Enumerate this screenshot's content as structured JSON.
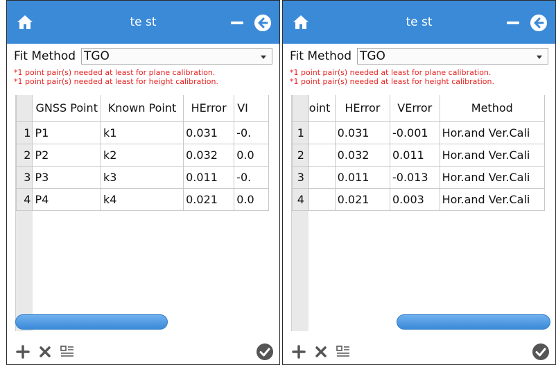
{
  "accent_color": "#3a8ad8",
  "window": {
    "title": "te st"
  },
  "fit_method": {
    "label": "Fit Method",
    "value": "TGO"
  },
  "warnings": [
    "*1 point pair(s) needed at least for plane calibration.",
    "*1 point pair(s) needed at least for height calibration."
  ],
  "icons": {
    "home": "home-icon",
    "minimize": "minimize-icon",
    "back": "back-arrow-icon",
    "add": "plus-icon",
    "delete": "x-icon",
    "list": "list-icon",
    "confirm": "check-circle-icon"
  },
  "left_table": {
    "headers": [
      "GNSS Point",
      "Known Point",
      "HError",
      "VI"
    ],
    "rows": [
      {
        "n": "1",
        "gnss": "P1",
        "known": "k1",
        "herror": "0.031",
        "partial": "-0."
      },
      {
        "n": "2",
        "gnss": "P2",
        "known": "k2",
        "herror": "0.032",
        "partial": "0.0"
      },
      {
        "n": "3",
        "gnss": "P3",
        "known": "k3",
        "herror": "0.011",
        "partial": "-0."
      },
      {
        "n": "4",
        "gnss": "P4",
        "known": "k4",
        "herror": "0.021",
        "partial": "0.0"
      }
    ]
  },
  "right_table": {
    "headers": [
      "oint",
      "HError",
      "VError",
      "Method"
    ],
    "rows": [
      {
        "n": "1",
        "herror": "0.031",
        "verror": "-0.001",
        "method": "Hor.and Ver.Cali"
      },
      {
        "n": "2",
        "herror": "0.032",
        "verror": "0.011",
        "method": "Hor.and Ver.Cali"
      },
      {
        "n": "3",
        "herror": "0.011",
        "verror": "-0.013",
        "method": "Hor.and Ver.Cali"
      },
      {
        "n": "4",
        "herror": "0.021",
        "verror": "0.003",
        "method": "Hor.and Ver.Cali"
      }
    ]
  }
}
